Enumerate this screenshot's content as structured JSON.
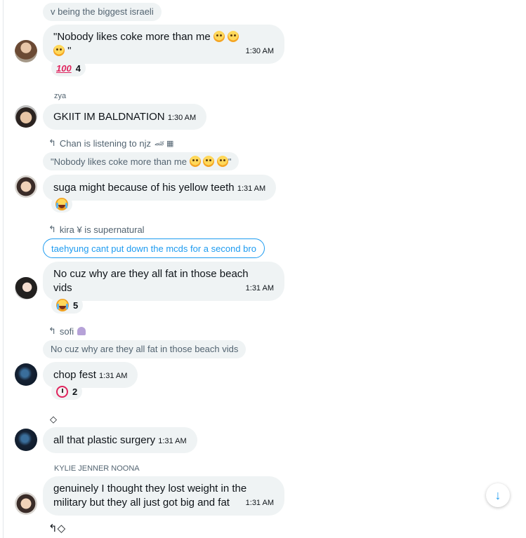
{
  "messages": [
    {
      "quote": "v being the biggest israeli",
      "text1": "\"Nobody likes coke more than me",
      "text2": "\"",
      "time": "1:30 AM",
      "reaction_count": "4"
    },
    {
      "name": "zya",
      "text": "GKIIT IM BALDNATION",
      "time": "1:30 AM"
    },
    {
      "reply": "Chan is listening to njz",
      "quote": "\"Nobody likes coke more than me",
      "quote_end": "\"",
      "text": "suga might because of his yellow teeth",
      "time": "1:31 AM"
    },
    {
      "reply": "kira ¥ is supernatural",
      "quote": "taehyung cant put down the mcds for a second bro",
      "text1": "No cuz why are they all fat in those beach",
      "text2": "vids",
      "time": "1:31 AM",
      "reaction_count": "5"
    },
    {
      "reply": "sofi",
      "quote": "No cuz why are they all fat in those beach vids",
      "text": "chop fest",
      "time": "1:31 AM",
      "reaction_count": "2"
    },
    {
      "icon_line": "◇",
      "text": "all that plastic surgery",
      "time": "1:31 AM"
    },
    {
      "name": "KYLIE JENNER NOONA",
      "text1": "genuinely I thought they lost weight in the",
      "text2": "military but they all just got big and fat",
      "time": "1:31 AM",
      "bottom_icons": "↰◇"
    }
  ],
  "icons": {
    "reply": "reply-arrow-icon",
    "scroll": "arrow-down-icon",
    "accent": "#1d9bf0"
  }
}
